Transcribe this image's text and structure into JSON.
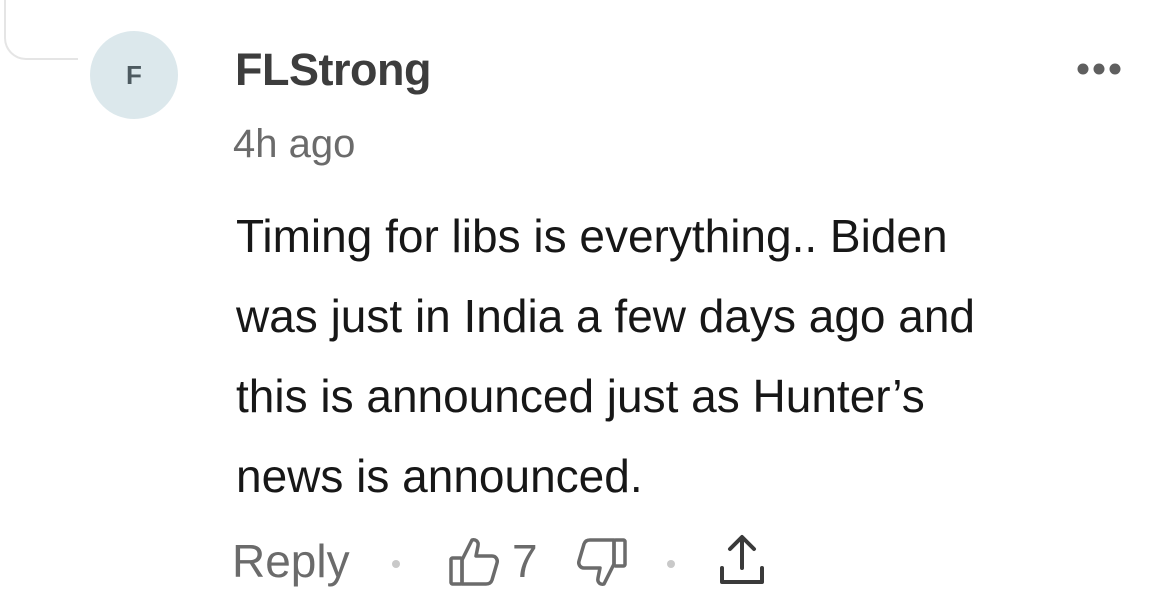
{
  "comment": {
    "avatar_letter": "F",
    "author": "FLStrong",
    "timestamp": "4h ago",
    "body_lines": [
      "Timing for libs is everything.. Biden",
      "was just in India a few days ago and",
      "this is announced just as Hunter’s",
      "news is announced."
    ]
  },
  "actions": {
    "reply_label": "Reply",
    "like_count": "7"
  },
  "icons": {
    "more": "more-options-icon",
    "like": "thumbs-up-icon",
    "dislike": "thumbs-down-icon",
    "share": "share-upload-icon"
  },
  "colors": {
    "avatar_bg": "#dce8ec",
    "author": "#3d3d3d",
    "muted": "#6b6b6b",
    "body": "#171717"
  }
}
